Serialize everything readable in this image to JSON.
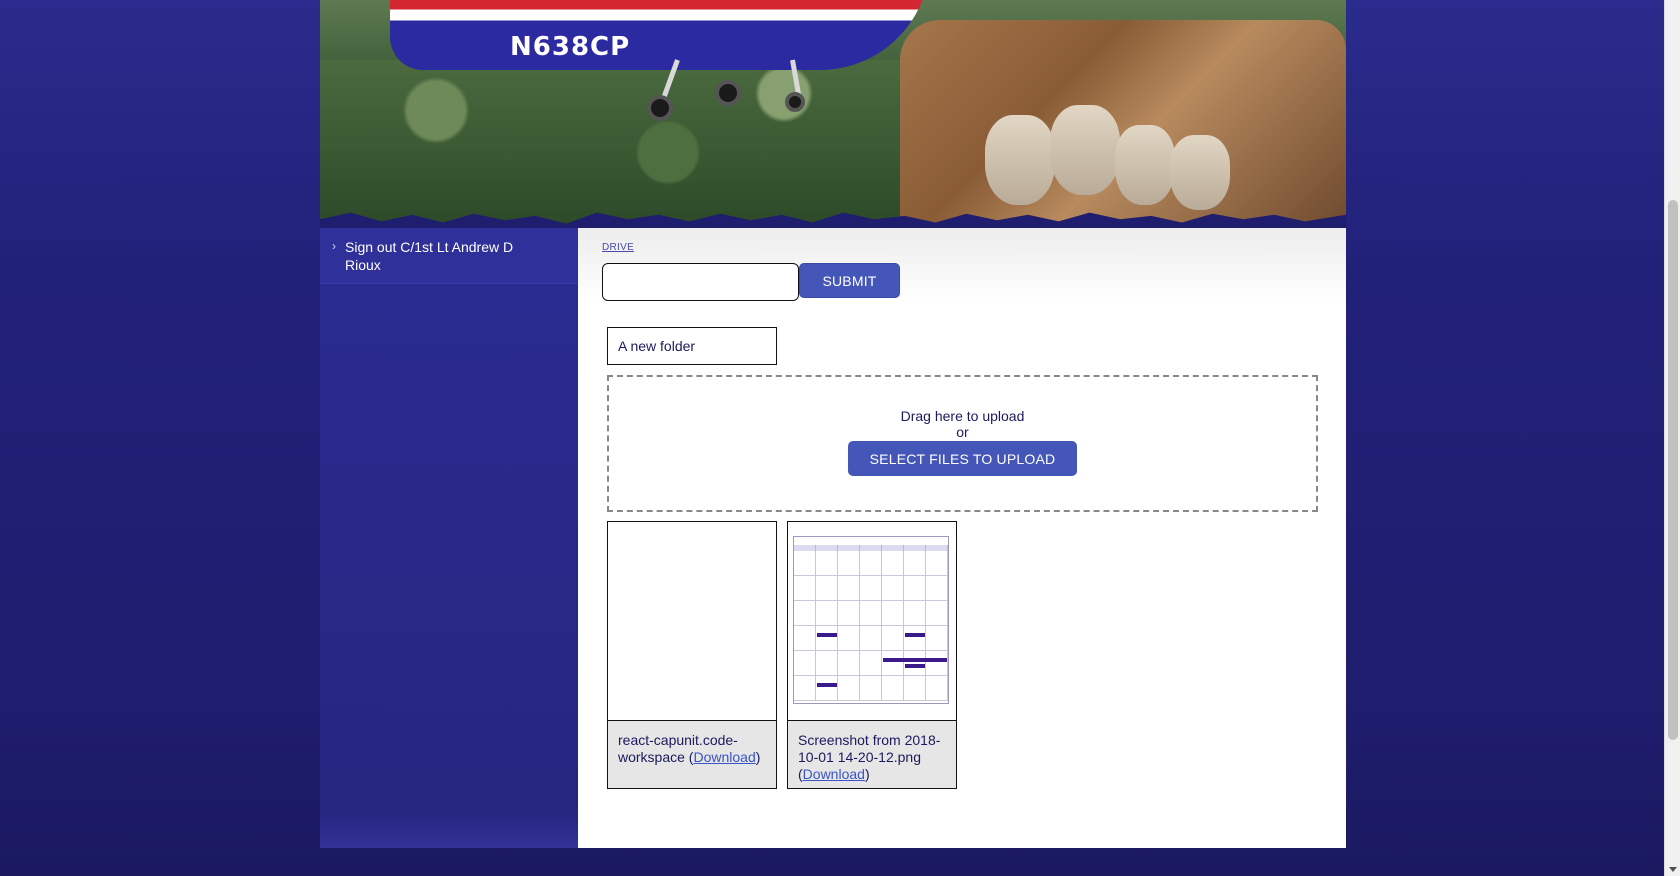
{
  "banner": {
    "tail_number": "N638CP"
  },
  "sidebar": {
    "items": [
      {
        "label": "Sign out C/1st Lt Andrew D Rioux",
        "icon": "chevron-right-icon"
      }
    ]
  },
  "main": {
    "breadcrumb": "DRIVE",
    "folder_input": {
      "value": "",
      "placeholder": ""
    },
    "submit_label": "SUBMIT",
    "folders": [
      {
        "name": "A new folder"
      }
    ],
    "upload": {
      "drag_text": "Drag here to upload",
      "or_text": "or",
      "select_label": "SELECT FILES TO UPLOAD"
    },
    "files": [
      {
        "name": "react-capunit.code-workspace",
        "download_label": "Download"
      },
      {
        "name": "Screenshot from 2018-10-01 14-20-12.png",
        "download_label": "Download"
      }
    ]
  },
  "colors": {
    "button_bg": "#4456b8",
    "page_bg": "#22217a",
    "link": "#3a55c8"
  }
}
